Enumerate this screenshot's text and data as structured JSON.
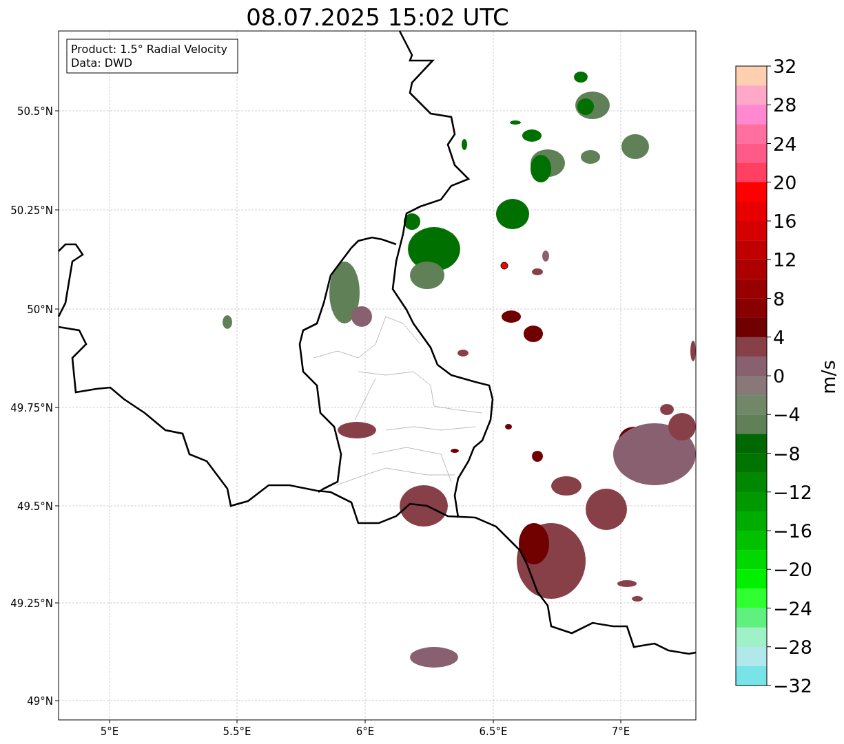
{
  "title": "08.07.2025 15:02 UTC",
  "info_box": [
    "Product: 1.5° Radial Velocity",
    "Data: DWD"
  ],
  "map": {
    "y_ticks": [
      "50.5°N",
      "50.25°N",
      "50°N",
      "49.75°N",
      "49.5°N",
      "49.25°N",
      "49°N"
    ],
    "x_ticks": [
      "5°E",
      "5.5°E",
      "6°E",
      "6.5°E",
      "7°E"
    ]
  },
  "colorbar": {
    "label": "m/s",
    "ticks": [
      "32",
      "28",
      "24",
      "20",
      "16",
      "12",
      "8",
      "4",
      "0",
      "−4",
      "−8",
      "−12",
      "−16",
      "−20",
      "−24",
      "−28",
      "−32"
    ],
    "segments": [
      {
        "color": "#ffd0b0"
      },
      {
        "color": "#ffa8c8"
      },
      {
        "color": "#ff88d0"
      },
      {
        "color": "#ff70a0"
      },
      {
        "color": "#ff5a88"
      },
      {
        "color": "#ff4060"
      },
      {
        "color": "#ff0000"
      },
      {
        "color": "#e80000"
      },
      {
        "color": "#d40000"
      },
      {
        "color": "#c00000"
      },
      {
        "color": "#ac0000"
      },
      {
        "color": "#980000"
      },
      {
        "color": "#880000"
      },
      {
        "color": "#700000"
      },
      {
        "color": "#884048"
      },
      {
        "color": "#886070"
      },
      {
        "color": "#887878"
      },
      {
        "color": "#708868"
      },
      {
        "color": "#608058"
      },
      {
        "color": "#006800"
      },
      {
        "color": "#007400"
      },
      {
        "color": "#008800"
      },
      {
        "color": "#009a00"
      },
      {
        "color": "#00ac00"
      },
      {
        "color": "#00c000"
      },
      {
        "color": "#00d800"
      },
      {
        "color": "#00f000"
      },
      {
        "color": "#30ff30"
      },
      {
        "color": "#60f080"
      },
      {
        "color": "#a0f0c8"
      },
      {
        "color": "#b0e8ec"
      },
      {
        "color": "#78e4e8"
      }
    ]
  }
}
